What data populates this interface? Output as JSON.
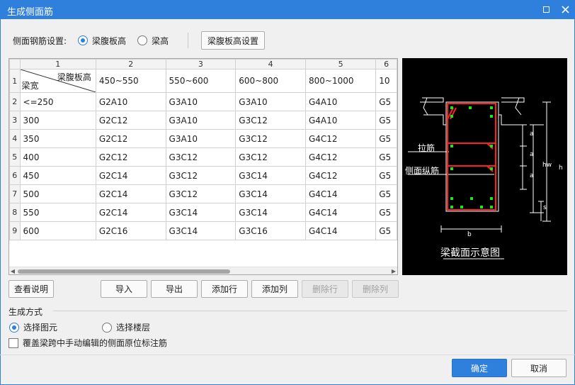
{
  "window": {
    "title": "生成侧面筋"
  },
  "setting": {
    "label": "侧面钢筋设置:",
    "option_web_height": "梁腹板高",
    "option_beam_height": "梁高",
    "selected": "梁腹板高",
    "config_button": "梁腹板高设置"
  },
  "grid": {
    "col_numbers": [
      "1",
      "2",
      "3",
      "4",
      "5",
      "6"
    ],
    "corner_top": "梁腹板高",
    "corner_bottom": "梁宽",
    "header_row_number": "1",
    "headers": [
      "450~550",
      "550~600",
      "600~800",
      "800~1000",
      "10"
    ],
    "rows": [
      {
        "num": "2",
        "width": "<=250",
        "cells": [
          "G2A10",
          "G3A10",
          "G3A10",
          "G4A10",
          "G5"
        ]
      },
      {
        "num": "3",
        "width": "300",
        "cells": [
          "G2C12",
          "G3A10",
          "G3C12",
          "G4A10",
          "G5"
        ]
      },
      {
        "num": "4",
        "width": "350",
        "cells": [
          "G2C12",
          "G3A10",
          "G3C12",
          "G4C12",
          "G5"
        ]
      },
      {
        "num": "5",
        "width": "400",
        "cells": [
          "G2C12",
          "G3C12",
          "G3C12",
          "G4C12",
          "G5"
        ]
      },
      {
        "num": "6",
        "width": "450",
        "cells": [
          "G2C14",
          "G3C12",
          "G3C14",
          "G4C12",
          "G5"
        ]
      },
      {
        "num": "7",
        "width": "500",
        "cells": [
          "G2C14",
          "G3C12",
          "G3C14",
          "G4C14",
          "G5"
        ]
      },
      {
        "num": "8",
        "width": "550",
        "cells": [
          "G2C14",
          "G3C14",
          "G3C14",
          "G4C14",
          "G5"
        ]
      },
      {
        "num": "9",
        "width": "600",
        "cells": [
          "G2C16",
          "G3C14",
          "G3C16",
          "G4C14",
          "G5"
        ]
      }
    ]
  },
  "diagram": {
    "label_tie": "拉筋",
    "label_side": "侧面纵筋",
    "label_a": "a",
    "label_hw": "hw",
    "label_h": "h",
    "label_s": "s",
    "label_b": "b",
    "caption": "梁截面示意图",
    "colors": {
      "outline": "#ffffff",
      "rebar": "#ff2020",
      "bars": "#22e022"
    }
  },
  "buttons": {
    "view_help": "查看说明",
    "import": "导入",
    "export": "导出",
    "add_row": "添加行",
    "add_col": "添加列",
    "del_row": "删除行",
    "del_col": "删除列",
    "ok": "确定",
    "cancel": "取消"
  },
  "generate": {
    "title": "生成方式",
    "option_element": "选择图元",
    "option_floor": "选择楼层",
    "selected": "选择图元"
  },
  "override": {
    "label": "覆盖梁跨中手动编辑的侧面原位标注筋",
    "checked": false
  }
}
